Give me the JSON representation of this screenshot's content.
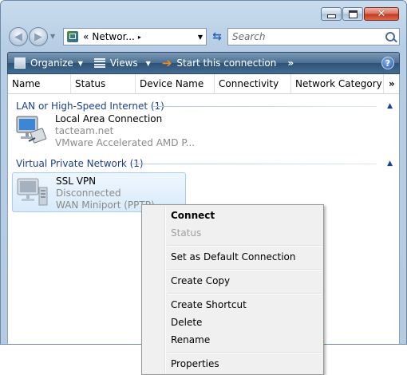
{
  "window": {
    "address": {
      "prefix": "«",
      "text": "Networ...",
      "chevron": "▸"
    },
    "search": {
      "placeholder": "Search"
    }
  },
  "toolbar": {
    "organize": "Organize",
    "views": "Views",
    "start": "Start this connection",
    "more": "»",
    "help": "?"
  },
  "columns": [
    {
      "label": "Name"
    },
    {
      "label": "Status"
    },
    {
      "label": "Device Name"
    },
    {
      "label": "Connectivity"
    },
    {
      "label": "Network Category"
    },
    {
      "label": "»"
    }
  ],
  "groups": [
    {
      "title": "LAN or High-Speed Internet (1)",
      "items": [
        {
          "name": "Local Area Connection",
          "line2": "tacteam.net",
          "line3": "VMware Accelerated AMD P...",
          "icon": "network-adapter-icon"
        }
      ]
    },
    {
      "title": "Virtual Private Network (1)",
      "items": [
        {
          "name": "SSL VPN",
          "line2": "Disconnected",
          "line3": "WAN Miniport (PPTP)",
          "icon": "vpn-connection-icon"
        }
      ]
    }
  ],
  "context_menu": {
    "items": [
      {
        "label": "Connect",
        "bold": true
      },
      {
        "label": "Status",
        "disabled": true
      },
      {
        "label": "Set as Default Connection"
      },
      {
        "label": "Create Copy"
      },
      {
        "label": "Create Shortcut"
      },
      {
        "label": "Delete"
      },
      {
        "label": "Rename"
      },
      {
        "label": "Properties"
      }
    ]
  },
  "colors": {
    "group_header": "#1e3f8a",
    "toolbar": "#3b6188",
    "selection": "#d8ebfa",
    "close_button": "#c3381f"
  }
}
